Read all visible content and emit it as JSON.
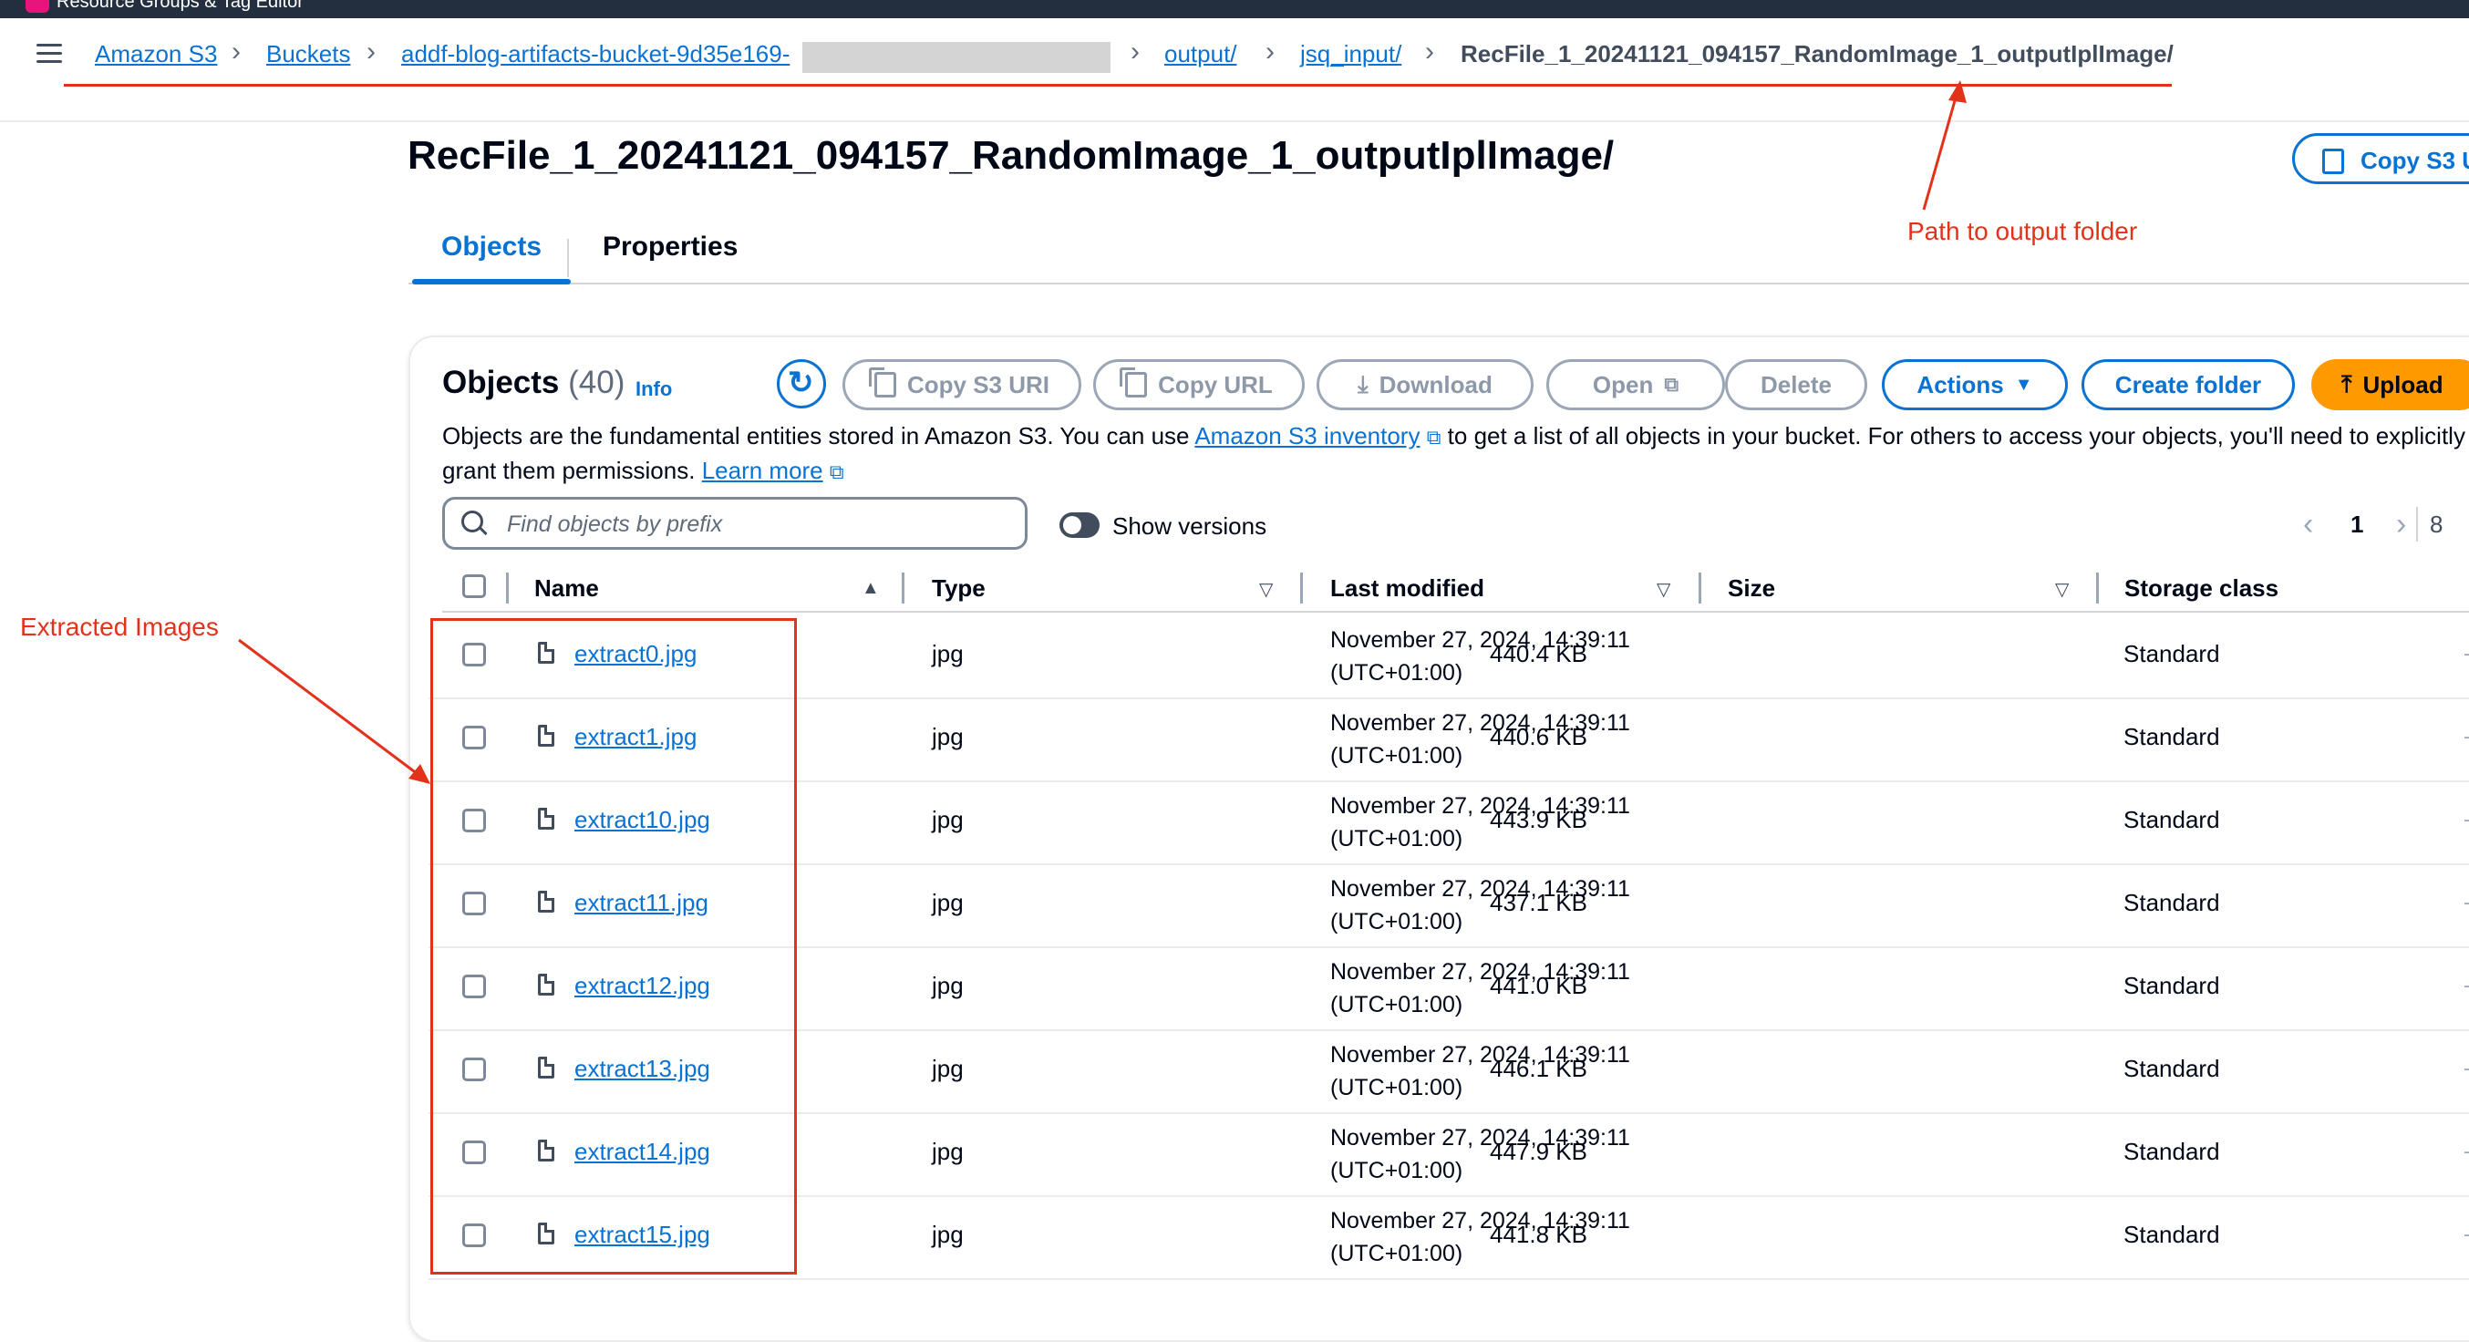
{
  "topbar": {
    "text": "Resource Groups & Tag Editor"
  },
  "breadcrumb": {
    "items": [
      "Amazon S3",
      "Buckets",
      "addf-blog-artifacts-bucket-9d35e169-",
      "output/",
      "jsq_input/"
    ],
    "current": "RecFile_1_20241121_094157_RandomImage_1_outputIplImage/"
  },
  "page": {
    "title": "RecFile_1_20241121_094157_RandomImage_1_outputIplImage/",
    "copy_uri_label": "Copy S3 U"
  },
  "tabs": [
    "Objects",
    "Properties"
  ],
  "annotations": {
    "path": "Path to output folder",
    "extracted": "Extracted Images"
  },
  "objects": {
    "heading": "Objects",
    "count": "(40)",
    "info": "Info",
    "desc_1": "Objects are the fundamental entities stored in Amazon S3. You can use",
    "desc_link": "Amazon S3 inventory",
    "desc_2": "to get a list of all objects in your bucket. For others to access your objects, you'll need to explicitly",
    "desc_3": "grant them permissions.",
    "learn_more": "Learn more"
  },
  "toolbar": {
    "copy_s3_uri": "Copy S3 URI",
    "copy_url": "Copy URL",
    "download": "Download",
    "open": "Open",
    "delete": "Delete",
    "actions": "Actions",
    "create_folder": "Create folder",
    "upload": "Upload"
  },
  "search": {
    "placeholder": "Find objects by prefix"
  },
  "versions": {
    "label": "Show versions"
  },
  "pagination": {
    "page": "1",
    "more": "8"
  },
  "table": {
    "headers": [
      "Name",
      "Type",
      "Last modified",
      "Size",
      "Storage class"
    ],
    "rows": [
      {
        "name": "extract0.jpg",
        "type": "jpg",
        "modified_1": "November 27, 2024, 14:39:11",
        "modified_2": "(UTC+01:00)",
        "size": "440.4 KB",
        "storage": "Standard"
      },
      {
        "name": "extract1.jpg",
        "type": "jpg",
        "modified_1": "November 27, 2024, 14:39:11",
        "modified_2": "(UTC+01:00)",
        "size": "440.6 KB",
        "storage": "Standard"
      },
      {
        "name": "extract10.jpg",
        "type": "jpg",
        "modified_1": "November 27, 2024, 14:39:11",
        "modified_2": "(UTC+01:00)",
        "size": "443.9 KB",
        "storage": "Standard"
      },
      {
        "name": "extract11.jpg",
        "type": "jpg",
        "modified_1": "November 27, 2024, 14:39:11",
        "modified_2": "(UTC+01:00)",
        "size": "437.1 KB",
        "storage": "Standard"
      },
      {
        "name": "extract12.jpg",
        "type": "jpg",
        "modified_1": "November 27, 2024, 14:39:11",
        "modified_2": "(UTC+01:00)",
        "size": "441.0 KB",
        "storage": "Standard"
      },
      {
        "name": "extract13.jpg",
        "type": "jpg",
        "modified_1": "November 27, 2024, 14:39:11",
        "modified_2": "(UTC+01:00)",
        "size": "446.1 KB",
        "storage": "Standard"
      },
      {
        "name": "extract14.jpg",
        "type": "jpg",
        "modified_1": "November 27, 2024, 14:39:11",
        "modified_2": "(UTC+01:00)",
        "size": "447.9 KB",
        "storage": "Standard"
      },
      {
        "name": "extract15.jpg",
        "type": "jpg",
        "modified_1": "November 27, 2024, 14:39:11",
        "modified_2": "(UTC+01:00)",
        "size": "441.8 KB",
        "storage": "Standard"
      }
    ]
  },
  "colors": {
    "link": "#0972d3",
    "upload": "#ff9900",
    "annotation": "#e2321a"
  }
}
